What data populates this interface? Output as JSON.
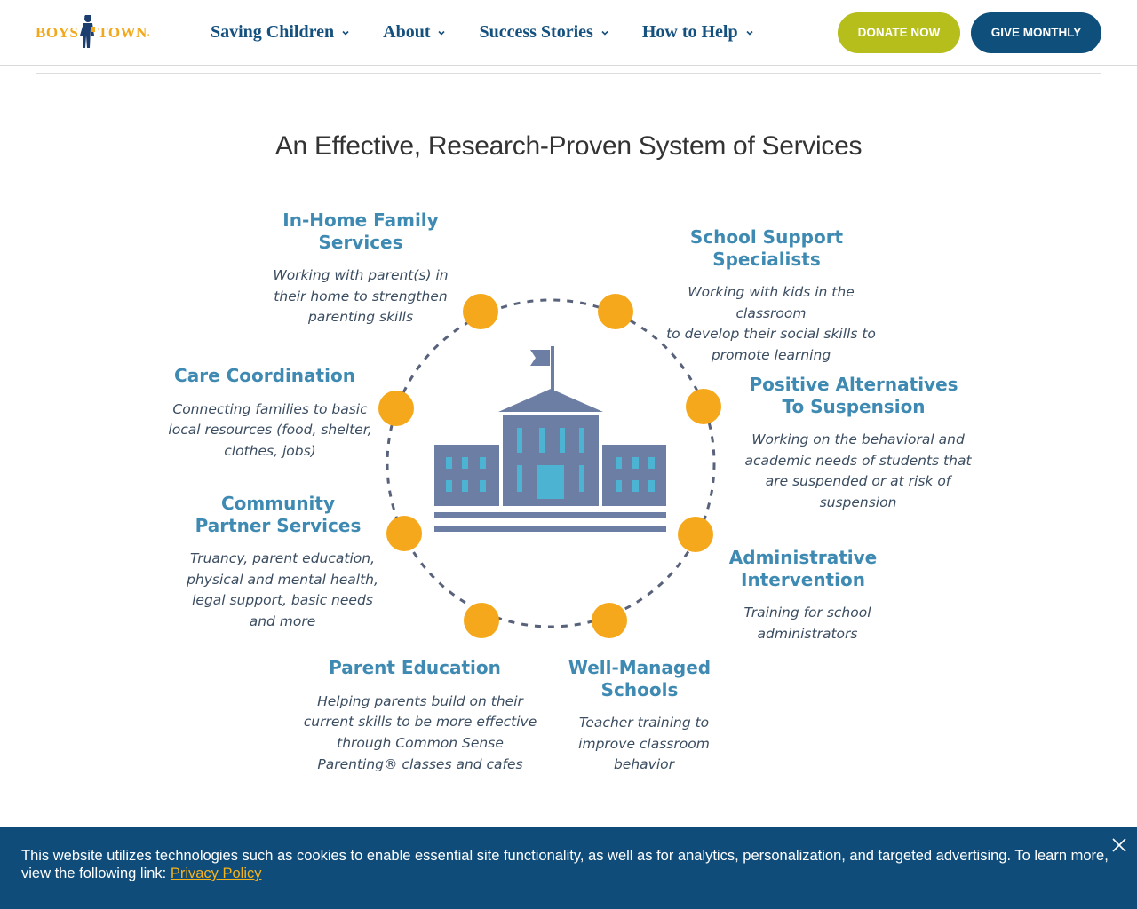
{
  "header": {
    "logo_left": "BOYS",
    "logo_right": "TOWN",
    "nav": [
      {
        "label": "Saving Children"
      },
      {
        "label": "About"
      },
      {
        "label": "Success Stories"
      },
      {
        "label": "How to Help"
      }
    ],
    "donate_label": "DONATE NOW",
    "monthly_label": "GIVE MONTHLY"
  },
  "main": {
    "title": "An Effective, Research-Proven System of Services"
  },
  "infographic": {
    "services": [
      {
        "title_lines": [
          "In-Home Family",
          "Services"
        ],
        "desc_lines": [
          "Working with parent(s) in",
          "their home to strengthen",
          "parenting skills"
        ]
      },
      {
        "title_lines": [
          "School Support",
          "Specialists"
        ],
        "desc_lines": [
          "Working with kids in the classroom",
          "to develop their social skills to",
          "promote learning"
        ]
      },
      {
        "title_lines": [
          "Care Coordination"
        ],
        "desc_lines": [
          "Connecting families to basic",
          "local resources (food, shelter,",
          "clothes, jobs)"
        ]
      },
      {
        "title_lines": [
          "Positive Alternatives",
          "To Suspension"
        ],
        "desc_lines": [
          "Working on the behavioral and",
          "academic needs of students that",
          "are suspended or at risk of",
          "suspension"
        ]
      },
      {
        "title_lines": [
          "Community",
          "Partner Services"
        ],
        "desc_lines": [
          "Truancy, parent education,",
          "physical and mental health,",
          "legal support, basic needs",
          "and more"
        ]
      },
      {
        "title_lines": [
          "Administrative",
          "Intervention"
        ],
        "desc_lines": [
          "Training for school",
          "administrators"
        ]
      },
      {
        "title_lines": [
          "Parent Education"
        ],
        "desc_lines": [
          "Helping parents build on their",
          "current skills to be more effective",
          "through Common Sense",
          "Parenting® classes and cafes"
        ]
      },
      {
        "title_lines": [
          "Well-Managed",
          "Schools"
        ],
        "desc_lines": [
          "Teacher training to",
          "improve classroom",
          "behavior"
        ]
      }
    ],
    "colors": {
      "heading": "#3e8ab2",
      "text": "#3b4d61",
      "dot": "#f5a81c",
      "building": "#6c7ea3",
      "window": "#4db3d3"
    }
  },
  "cookie": {
    "text": "This website utilizes technologies such as cookies to enable essential site functionality, as well as for analytics, personalization, and targeted advertising. To learn more, view the following link: ",
    "link_label": "Privacy Policy"
  },
  "icons": {
    "nav_chevron": "chevron-down-icon",
    "close": "close-icon",
    "building": "school-building-icon"
  }
}
